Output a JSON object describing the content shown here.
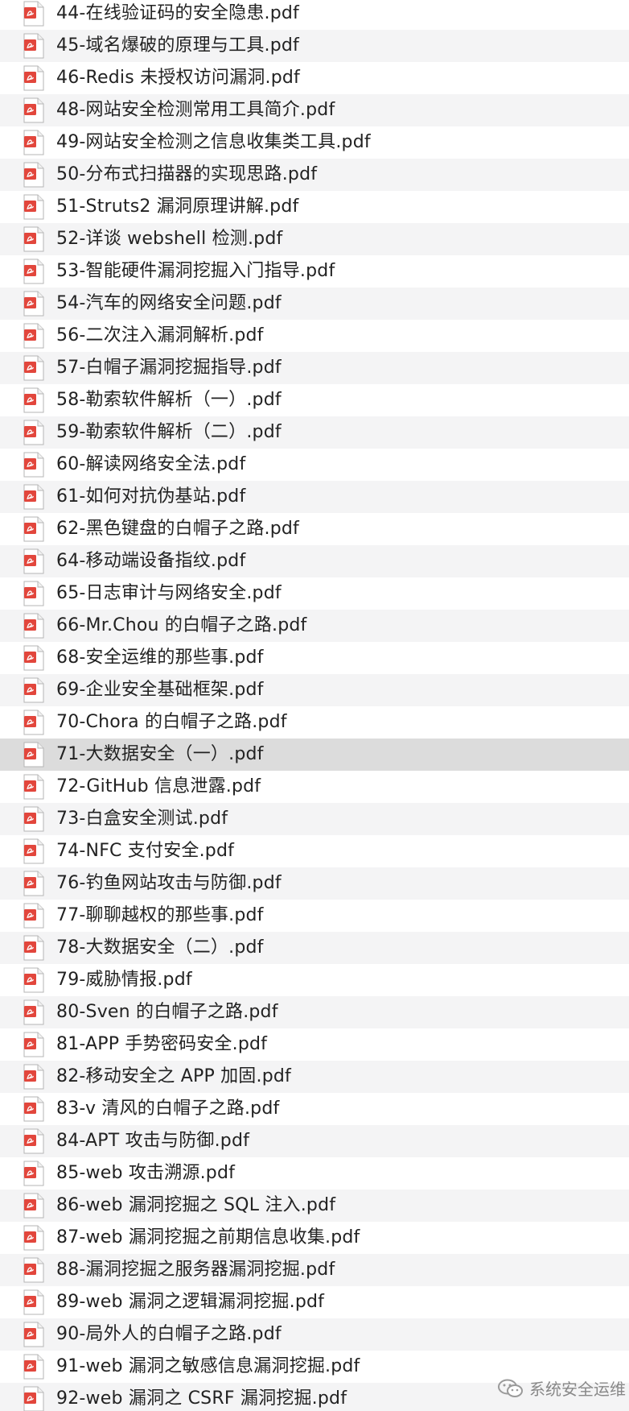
{
  "accent_color": "#e2463c",
  "selected_index": 23,
  "files": [
    {
      "label": "44-在线验证码的安全隐患.pdf"
    },
    {
      "label": "45-域名爆破的原理与工具.pdf"
    },
    {
      "label": "46-Redis 未授权访问漏洞.pdf"
    },
    {
      "label": "48-网站安全检测常用工具简介.pdf"
    },
    {
      "label": "49-网站安全检测之信息收集类工具.pdf"
    },
    {
      "label": "50-分布式扫描器的实现思路.pdf"
    },
    {
      "label": "51-Struts2 漏洞原理讲解.pdf"
    },
    {
      "label": "52-详谈 webshell 检测.pdf"
    },
    {
      "label": "53-智能硬件漏洞挖掘入门指导.pdf"
    },
    {
      "label": "54-汽车的网络安全问题.pdf"
    },
    {
      "label": "56-二次注入漏洞解析.pdf"
    },
    {
      "label": "57-白帽子漏洞挖掘指导.pdf"
    },
    {
      "label": "58-勒索软件解析（一）.pdf"
    },
    {
      "label": "59-勒索软件解析（二）.pdf"
    },
    {
      "label": "60-解读网络安全法.pdf"
    },
    {
      "label": "61-如何对抗伪基站.pdf"
    },
    {
      "label": "62-黑色键盘的白帽子之路.pdf"
    },
    {
      "label": "64-移动端设备指纹.pdf"
    },
    {
      "label": "65-日志审计与网络安全.pdf"
    },
    {
      "label": "66-Mr.Chou 的白帽子之路.pdf"
    },
    {
      "label": "68-安全运维的那些事.pdf"
    },
    {
      "label": "69-企业安全基础框架.pdf"
    },
    {
      "label": "70-Chora 的白帽子之路.pdf"
    },
    {
      "label": "71-大数据安全（一）.pdf"
    },
    {
      "label": "72-GitHub 信息泄露.pdf"
    },
    {
      "label": "73-白盒安全测试.pdf"
    },
    {
      "label": "74-NFC 支付安全.pdf"
    },
    {
      "label": "76-钓鱼网站攻击与防御.pdf"
    },
    {
      "label": "77-聊聊越权的那些事.pdf"
    },
    {
      "label": "78-大数据安全（二）.pdf"
    },
    {
      "label": "79-威胁情报.pdf"
    },
    {
      "label": "80-Sven 的白帽子之路.pdf"
    },
    {
      "label": "81-APP 手势密码安全.pdf"
    },
    {
      "label": "82-移动安全之 APP 加固.pdf"
    },
    {
      "label": "83-v 清风的白帽子之路.pdf"
    },
    {
      "label": "84-APT 攻击与防御.pdf"
    },
    {
      "label": "85-web 攻击溯源.pdf"
    },
    {
      "label": "86-web 漏洞挖掘之 SQL 注入.pdf"
    },
    {
      "label": "87-web 漏洞挖掘之前期信息收集.pdf"
    },
    {
      "label": "88-漏洞挖掘之服务器漏洞挖掘.pdf"
    },
    {
      "label": "89-web 漏洞之逻辑漏洞挖掘.pdf"
    },
    {
      "label": "90-局外人的白帽子之路.pdf"
    },
    {
      "label": "91-web 漏洞之敏感信息漏洞挖掘.pdf"
    },
    {
      "label": "92-web 漏洞之 CSRF 漏洞挖掘.pdf"
    }
  ],
  "watermark": {
    "text": "系统安全运维",
    "icon": "wechat-icon"
  }
}
